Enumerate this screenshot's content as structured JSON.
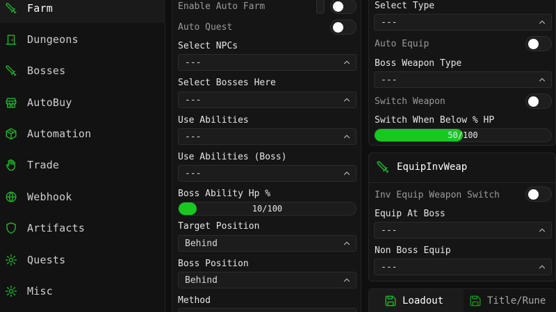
{
  "sidebar": {
    "items": [
      {
        "label": "Farm",
        "icon": "sword-icon",
        "active": true
      },
      {
        "label": "Dungeons",
        "icon": "door-icon"
      },
      {
        "label": "Bosses",
        "icon": "sword-icon"
      },
      {
        "label": "AutoBuy",
        "icon": "shop-icon"
      },
      {
        "label": "Automation",
        "icon": "box-icon"
      },
      {
        "label": "Trade",
        "icon": "hand-icon"
      },
      {
        "label": "Webhook",
        "icon": "globe-icon"
      },
      {
        "label": "Artifacts",
        "icon": "shield-icon"
      },
      {
        "label": "Quests",
        "icon": "cog-icon"
      },
      {
        "label": "Misc",
        "icon": "cog-icon"
      }
    ]
  },
  "farm": {
    "enable_auto_farm": {
      "label": "Enable Auto Farm",
      "on": false
    },
    "auto_quest": {
      "label": "Auto Quest",
      "on": false
    },
    "select_npcs": {
      "label": "Select NPCs",
      "value": "---"
    },
    "select_bosses": {
      "label": "Select Bosses Here",
      "value": "---"
    },
    "use_abilities": {
      "label": "Use Abilities",
      "value": "---"
    },
    "use_abilities_boss": {
      "label": "Use Abilities (Boss)",
      "value": "---"
    },
    "boss_ability_hp": {
      "label": "Boss Ability Hp %",
      "value": 10,
      "max": 100,
      "text": "10/100"
    },
    "target_position": {
      "label": "Target Position",
      "value": "Behind"
    },
    "boss_position": {
      "label": "Boss Position",
      "value": "Behind"
    },
    "method": {
      "label": "Method"
    }
  },
  "weapon": {
    "select_type": {
      "label": "Select Type",
      "value": "---"
    },
    "auto_equip": {
      "label": "Auto Equip",
      "on": false
    },
    "boss_weapon_type": {
      "label": "Boss Weapon Type",
      "value": "---"
    },
    "switch_weapon": {
      "label": "Switch Weapon",
      "on": false
    },
    "switch_below_hp": {
      "label": "Switch When Below % HP",
      "value": 50,
      "max": 100,
      "text": "50/100"
    }
  },
  "equip_inv": {
    "title": "EquipInvWeap",
    "inv_equip_switch": {
      "label": "Inv Equip Weapon Switch",
      "on": false
    },
    "equip_at_boss": {
      "label": "Equip At Boss",
      "value": "---"
    },
    "non_boss_equip": {
      "label": "Non Boss Equip",
      "value": "---"
    }
  },
  "bottom_tabs": {
    "loadout": "Loadout",
    "title_rune": "Title/Rune"
  },
  "colors": {
    "accent": "#1fae2a",
    "fill": "#18c821"
  }
}
